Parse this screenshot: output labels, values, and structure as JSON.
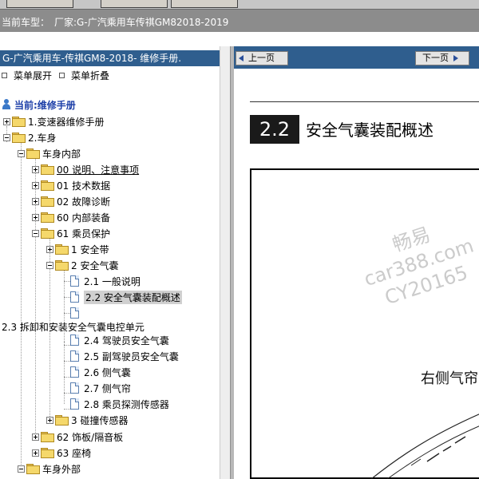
{
  "top_bar": {
    "vehicle_label": "当前车型：",
    "vehicle_value": "厂家:G-广汽乘用车传祺GM82018-2019"
  },
  "left_panel": {
    "header": "G-广汽乘用车-传祺GM8-2018- 维修手册.",
    "expand_all": "菜单展开",
    "collapse_all": "菜单折叠",
    "current": "当前:维修手册",
    "tree": {
      "transmission": "1.变速器维修手册",
      "body": "2.车身",
      "interior": "车身内部",
      "notes": "00 说明、注意事项",
      "tech_data": "01 技术数据",
      "diagnosis": "02 故障诊断",
      "interior_equipment": "60 内部装备",
      "occupant_protection": "61 乘员保护",
      "seat_belt": "1 安全带",
      "airbag": "2 安全气囊",
      "general_description": "2.1 一般说明",
      "airbag_assembly_overview": "2.2 安全气囊装配概述",
      "remove_install_control_unit": "2.3 拆卸和安装安全气囊电控单元",
      "driver_airbag": "2.4 驾驶员安全气囊",
      "passenger_airbag": "2.5 副驾驶员安全气囊",
      "side_airbag": "2.6 侧气囊",
      "side_curtain": "2.7 侧气帘",
      "occupant_sensor": "2.8 乘员探测传感器",
      "crash_sensor": "3 碰撞传感器",
      "trim_panel": "62 饰板/隔音板",
      "seats": "63 座椅",
      "exterior": "车身外部"
    }
  },
  "right_panel": {
    "prev_page": "上一页",
    "next_page": "下一页",
    "section_number": "2.2",
    "section_title": "安全气囊装配概述",
    "caption": "右侧气帘",
    "watermark": [
      "畅易",
      "car388.com",
      "CY20165"
    ]
  }
}
